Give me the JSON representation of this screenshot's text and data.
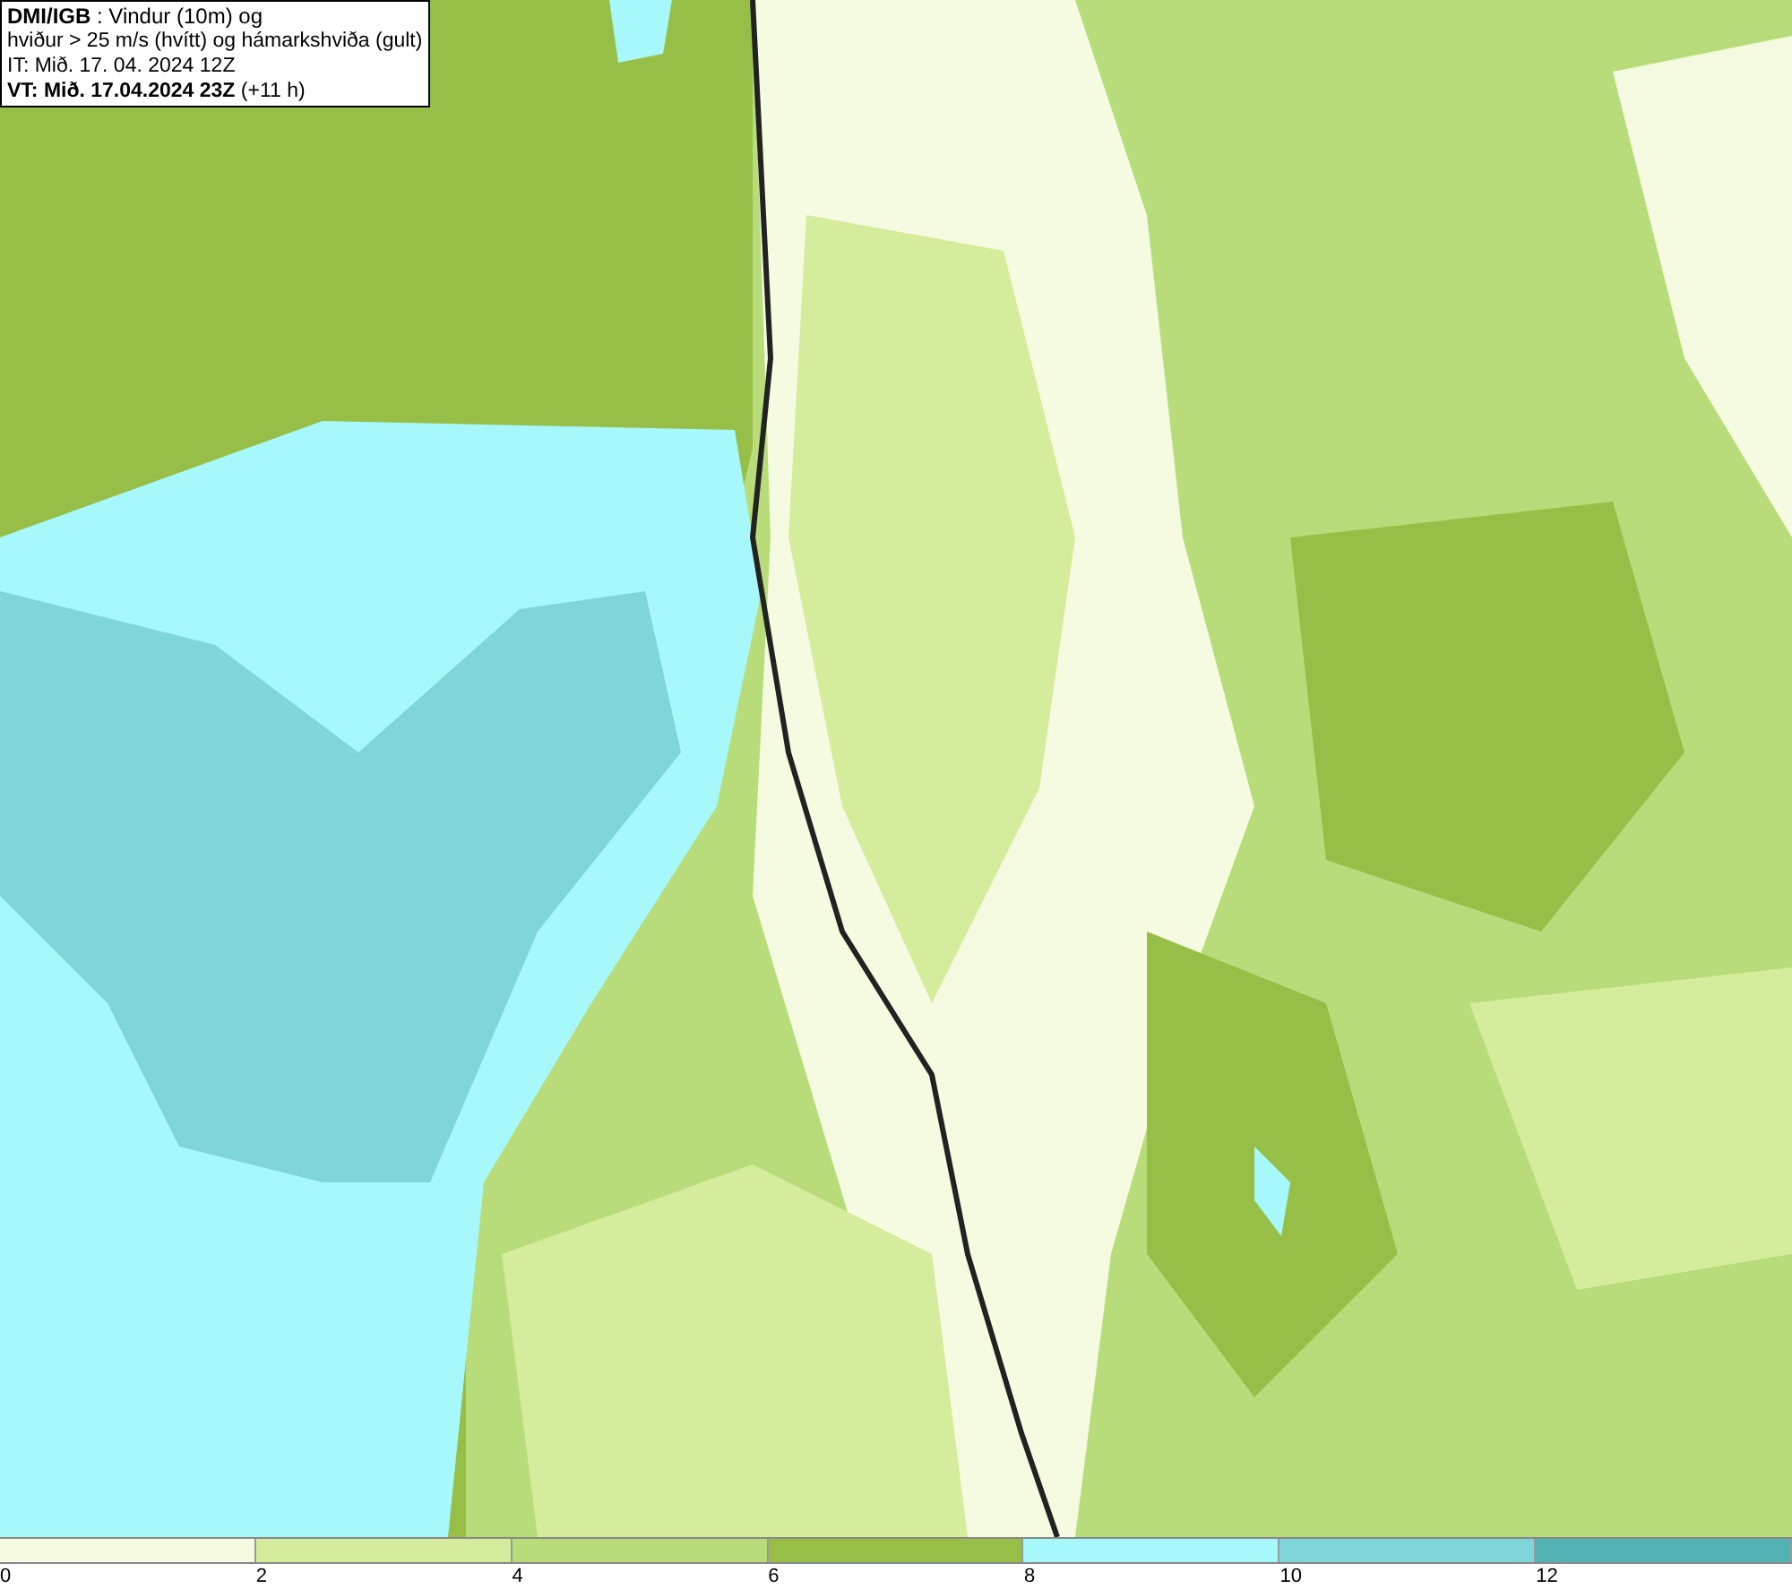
{
  "info_box": {
    "lines": [
      "**DMI/IGB** : Vindur (10m) og",
      "hviður > 25 m/s (hvítt) og hámarkshviða (gult)",
      "IT: Mið. 17. 04. 2024 12Z",
      "**VT: Mið. 17.04.2024 23Z** (+11 h)"
    ]
  },
  "legend": [
    {
      "label": "0",
      "color": "#f5fbe0"
    },
    {
      "label": "2",
      "color": "#d4ec9c"
    },
    {
      "label": "4",
      "color": "#b8dc7a"
    },
    {
      "label": "6",
      "color": "#97bf48"
    },
    {
      "label": "8",
      "color": "#a6f8fa"
    },
    {
      "label": "10",
      "color": "#7fd6d8"
    },
    {
      "label": "12",
      "color": "#52b2b4"
    }
  ]
}
